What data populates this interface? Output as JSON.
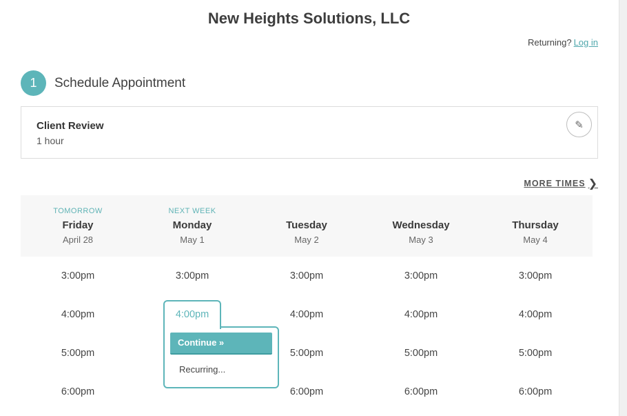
{
  "business": {
    "name": "New Heights Solutions, LLC"
  },
  "login": {
    "prompt": "Returning?",
    "link": "Log in"
  },
  "step": {
    "number": "1",
    "title": "Schedule Appointment"
  },
  "appointment": {
    "name": "Client Review",
    "duration": "1 hour",
    "edit_icon": "pencil-icon"
  },
  "more_times": {
    "label": "MORE TIMES",
    "icon": "chevron-right-icon"
  },
  "days": [
    {
      "tag": "TOMORROW",
      "name": "Friday",
      "date": "April 28",
      "slots": [
        "3:00pm",
        "4:00pm",
        "5:00pm",
        "6:00pm"
      ]
    },
    {
      "tag": "NEXT WEEK",
      "name": "Monday",
      "date": "May 1",
      "slots": [
        "3:00pm",
        "4:00pm"
      ]
    },
    {
      "tag": "",
      "name": "Tuesday",
      "date": "May 2",
      "slots": [
        "3:00pm",
        "4:00pm",
        "5:00pm",
        "6:00pm"
      ]
    },
    {
      "tag": "",
      "name": "Wednesday",
      "date": "May 3",
      "slots": [
        "3:00pm",
        "4:00pm",
        "5:00pm",
        "6:00pm"
      ]
    },
    {
      "tag": "",
      "name": "Thursday",
      "date": "May 4",
      "slots": [
        "3:00pm",
        "4:00pm",
        "5:00pm",
        "6:00pm"
      ]
    }
  ],
  "popup": {
    "selected_time": "4:00pm",
    "continue_label": "Continue »",
    "recurring_label": "Recurring..."
  },
  "colors": {
    "accent": "#5db5b9",
    "link": "#4fa7ac",
    "header_bg": "#f7f7f7"
  }
}
